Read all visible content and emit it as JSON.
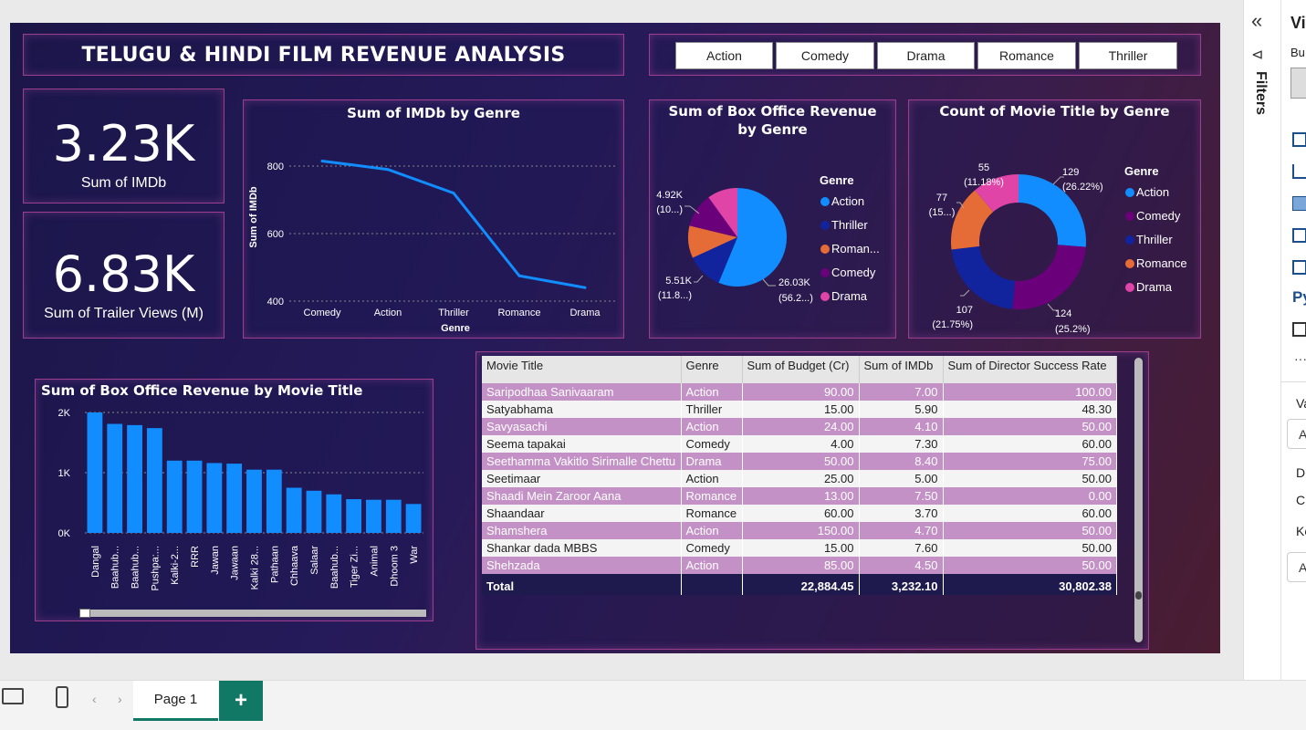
{
  "title": "TELUGU & HINDI FILM  REVENUE ANALYSIS",
  "slicer": [
    "Action",
    "Comedy",
    "Drama",
    "Romance",
    "Thriller"
  ],
  "kpis": [
    {
      "value": "3.23K",
      "label": "Sum of IMDb"
    },
    {
      "value": "6.83K",
      "label": "Sum of Trailer Views (M)"
    }
  ],
  "colors": {
    "action": "#118dff",
    "thriller": "#12239e",
    "romance": "#e66c37",
    "comedy": "#6b007b",
    "drama": "#e044a7",
    "bar": "#118dff",
    "line": "#118dff"
  },
  "imdb_chart": {
    "title": "Sum of IMDb by Genre",
    "ylabel": "Sum of IMDb",
    "xlabel": "Genre"
  },
  "revenue_pie": {
    "title": "Sum of Box Office Revenue by Genre",
    "legend_title": "Genre",
    "legend": [
      "Action",
      "Thriller",
      "Roman...",
      "Comedy",
      "Drama"
    ],
    "labels": [
      "26.03K",
      "(56.2...)",
      "5.51K",
      "(11.8...)",
      "4.92K",
      "(10...)"
    ]
  },
  "count_donut": {
    "title": "Count of Movie Title by Genre",
    "legend_title": "Genre",
    "legend": [
      "Action",
      "Comedy",
      "Thriller",
      "Romance",
      "Drama"
    ],
    "labels": [
      "129",
      "(26.22%)",
      "124",
      "(25.2%)",
      "107",
      "(21.75%)",
      "77",
      "(15...)",
      "55",
      "(11.18%)"
    ]
  },
  "bar_chart": {
    "title": "Sum of Box Office Revenue by Movie Title"
  },
  "chart_data": [
    {
      "type": "line",
      "title": "Sum of IMDb by Genre",
      "xlabel": "Genre",
      "ylabel": "Sum of IMDb",
      "categories": [
        "Comedy",
        "Action",
        "Thriller",
        "Romance",
        "Drama"
      ],
      "values": [
        815,
        790,
        720,
        475,
        440
      ],
      "ylim": [
        400,
        830
      ],
      "yticks": [
        "800",
        "600",
        "400"
      ],
      "grid": true
    },
    {
      "type": "pie",
      "title": "Sum of Box Office Revenue by Genre",
      "categories": [
        "Action",
        "Thriller",
        "Romance",
        "Comedy",
        "Drama"
      ],
      "values": [
        26030,
        5510,
        4920,
        5200,
        4620
      ],
      "legend": "right"
    },
    {
      "type": "pie",
      "title": "Count of Movie Title by Genre",
      "categories": [
        "Action",
        "Comedy",
        "Thriller",
        "Romance",
        "Drama"
      ],
      "values": [
        129,
        124,
        107,
        77,
        55
      ],
      "legend": "right"
    },
    {
      "type": "bar",
      "title": "Sum of Box Office Revenue by Movie Title",
      "categories": [
        "Dangal",
        "Baahub...",
        "Baahub...",
        "Pushpa:...",
        "Kalki-2...",
        "RRR",
        "Jawan",
        "Jawaan",
        "Kalki 28...",
        "Pathaan",
        "Chhaava",
        "Salaar",
        "Baahub...",
        "Tiger Zi...",
        "Animal",
        "Dhoom 3",
        "War"
      ],
      "values": [
        2000,
        1810,
        1790,
        1740,
        1200,
        1200,
        1160,
        1150,
        1050,
        1050,
        750,
        700,
        640,
        560,
        550,
        550,
        480
      ],
      "ylim": [
        0,
        2000
      ],
      "yticks": [
        "2K",
        "1K",
        "0K"
      ],
      "grid": true
    }
  ],
  "table": {
    "columns": [
      "Movie Title",
      "Genre",
      "Sum of Budget (Cr)",
      "Sum of IMDb",
      "Sum of Director Success Rate"
    ],
    "rows": [
      [
        "Saripodhaa Sanivaaram",
        "Action",
        "90.00",
        "7.00",
        "100.00"
      ],
      [
        "Satyabhama",
        "Thriller",
        "15.00",
        "5.90",
        "48.30"
      ],
      [
        "Savyasachi",
        "Action",
        "24.00",
        "4.10",
        "50.00"
      ],
      [
        "Seema tapakai",
        "Comedy",
        "4.00",
        "7.30",
        "60.00"
      ],
      [
        "Seethamma Vakitlo Sirimalle Chettu",
        "Drama",
        "50.00",
        "8.40",
        "75.00"
      ],
      [
        "Seetimaar",
        "Action",
        "25.00",
        "5.00",
        "50.00"
      ],
      [
        "Shaadi Mein Zaroor Aana",
        "Romance",
        "13.00",
        "7.50",
        "0.00"
      ],
      [
        "Shaandaar",
        "Romance",
        "60.00",
        "3.70",
        "60.00"
      ],
      [
        "Shamshera",
        "Action",
        "150.00",
        "4.70",
        "50.00"
      ],
      [
        "Shankar dada MBBS",
        "Comedy",
        "15.00",
        "7.60",
        "50.00"
      ],
      [
        "Shehzada",
        "Action",
        "85.00",
        "4.50",
        "50.00"
      ]
    ],
    "total": [
      "Total",
      "",
      "22,884.45",
      "3,232.10",
      "30,802.38"
    ]
  },
  "right_pane": {
    "filters_label": "Filters"
  },
  "bottom": {
    "page_tab": "Page 1",
    "add": "+"
  }
}
